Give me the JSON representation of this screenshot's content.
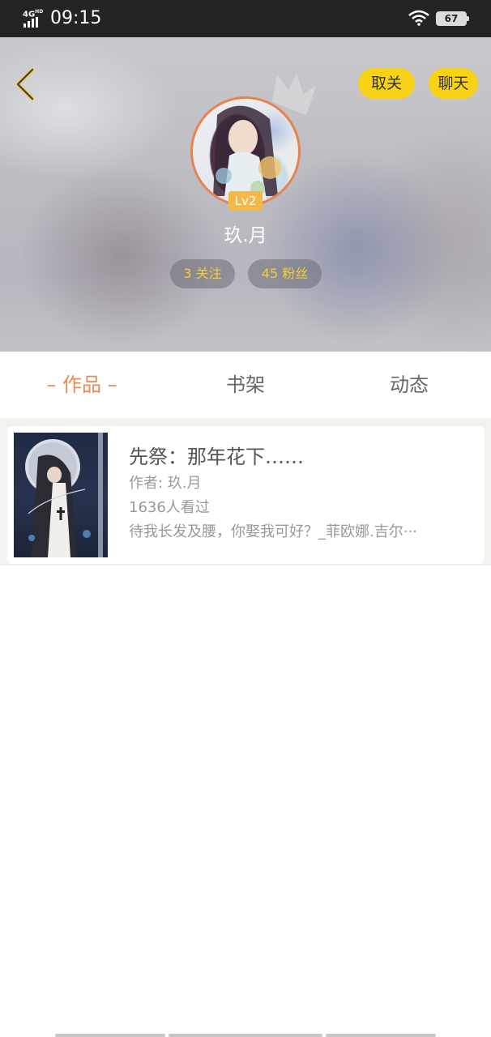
{
  "status_bar": {
    "network": "4G",
    "network_sup": "HD",
    "time": "09:15",
    "battery": "67"
  },
  "header": {
    "unfollow_label": "取关",
    "chat_label": "聊天",
    "level": "Lv2",
    "nickname": "玖.月",
    "following": "3 关注",
    "fans": "45 粉丝",
    "accent_color": "#f7d217"
  },
  "tabs": [
    {
      "label": "– 作品 –",
      "active": true
    },
    {
      "label": "书架",
      "active": false
    },
    {
      "label": "动态",
      "active": false
    }
  ],
  "works": [
    {
      "title": "先祭：那年花下……",
      "author": "作者: 玖.月",
      "views": "1636人看过",
      "description": "待我长发及腰，你娶我可好？_菲欧娜.吉尔···"
    }
  ],
  "icons": {
    "back": "chevron-left-icon",
    "wifi": "wifi-icon",
    "signal": "signal-icon",
    "crown": "crown-icon"
  }
}
